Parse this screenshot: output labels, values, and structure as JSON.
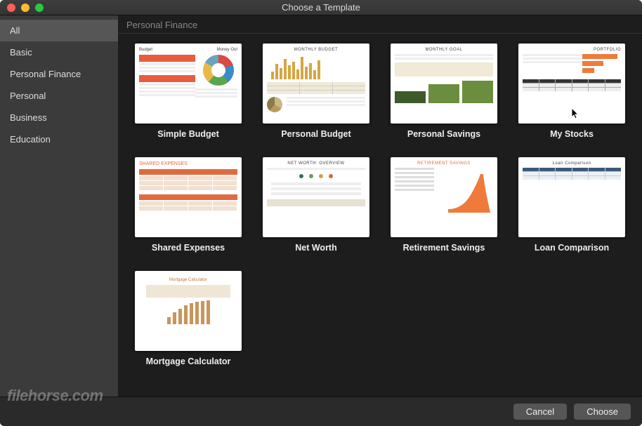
{
  "window": {
    "title": "Choose a Template"
  },
  "sidebar": {
    "items": [
      {
        "label": "All",
        "selected": true
      },
      {
        "label": "Basic"
      },
      {
        "label": "Personal Finance"
      },
      {
        "label": "Personal"
      },
      {
        "label": "Business"
      },
      {
        "label": "Education"
      }
    ]
  },
  "section": {
    "header": "Personal Finance"
  },
  "templates": [
    {
      "key": "simple-budget",
      "label": "Simple Budget"
    },
    {
      "key": "personal-budget",
      "label": "Personal Budget"
    },
    {
      "key": "personal-savings",
      "label": "Personal Savings"
    },
    {
      "key": "my-stocks",
      "label": "My Stocks"
    },
    {
      "key": "shared-expenses",
      "label": "Shared Expenses"
    },
    {
      "key": "net-worth",
      "label": "Net Worth"
    },
    {
      "key": "retirement-savings",
      "label": "Retirement Savings"
    },
    {
      "key": "loan-comparison",
      "label": "Loan Comparison"
    },
    {
      "key": "mortgage-calculator",
      "label": "Mortgage Calculator"
    }
  ],
  "thumbnail_text": {
    "simple_budget": {
      "title_left": "Budget",
      "title_right": "Money Out"
    },
    "personal_budget": {
      "title": "MONTHLY BUDGET"
    },
    "personal_savings": {
      "title": "MONTHLY GOAL"
    },
    "my_stocks": {
      "title": "PORTFOLIO"
    },
    "shared_expenses": {
      "title": "SHARED EXPENSES"
    },
    "net_worth": {
      "title": "NET WORTH: OVERVIEW"
    },
    "retirement_savings": {
      "title": "RETIREMENT SAVINGS"
    },
    "loan_comparison": {
      "title": "Loan Comparison"
    },
    "mortgage_calculator": {
      "title": "Mortgage Calculator"
    }
  },
  "footer": {
    "cancel": "Cancel",
    "choose": "Choose"
  },
  "watermark": "filehorse.com"
}
